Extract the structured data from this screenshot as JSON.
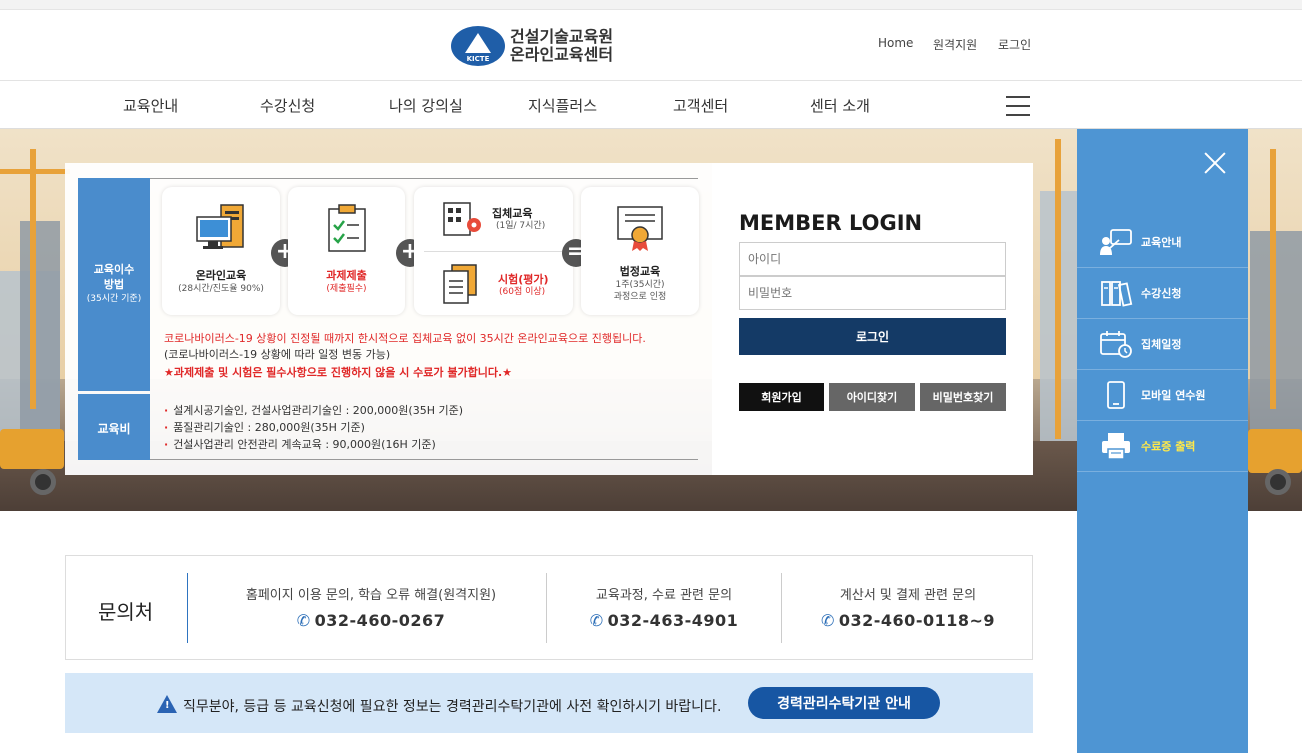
{
  "header": {
    "logo_line1": "건설기술교육원",
    "logo_line2": "온라인교육센터",
    "logo_mark_text": "KICTE",
    "util": [
      "Home",
      "원격지원",
      "로그인"
    ]
  },
  "gnb": {
    "items": [
      "교육안내",
      "수강신청",
      "나의 강의실",
      "지식플러스",
      "고객센터",
      "센터 소개"
    ]
  },
  "info": {
    "method_label_1": "교육이수",
    "method_label_2": "방법",
    "method_label_3": "(35시간 기준)",
    "fee_label": "교육비",
    "card1_title": "온라인교육",
    "card1_sub": "(28시간/진도율 90%)",
    "card2_title": "과제제출",
    "card2_sub": "(제출필수)",
    "card3_title": "집체교육",
    "card3_sub": "(1일/ 7시간)",
    "card3b_title": "시험(평가)",
    "card3b_sub": "(60점 이상)",
    "card4_title": "법정교육",
    "card4_sub1": "1주(35시간)",
    "card4_sub2": "과정으로 인정",
    "op_plus": "+",
    "op_equal": "=",
    "notice1": "코로나바이러스-19 상황이 진정될 때까지 한시적으로 집체교육 없이 35시간 온라인교육으로 진행됩니다.",
    "notice2": "(코로나바이러스-19 상황에 따라 일정 변동 가능)",
    "notice3": "★과제제출 및 시험은 필수사항으로 진행하지 않을 시 수료가 불가합니다.★",
    "fees": [
      "설계시공기술인, 건설사업관리기술인 : 200,000원(35H 기준)",
      "품질관리기술인 : 280,000원(35H 기준)",
      "건설사업관리 안전관리 계속교육 : 90,000원(16H 기준)"
    ]
  },
  "login": {
    "title": "MEMBER LOGIN",
    "id_placeholder": "아이디",
    "pw_placeholder": "비밀번호",
    "login_button": "로그인",
    "join_button": "회원가입",
    "find_id_button": "아이디찾기",
    "find_pw_button": "비밀번호찾기"
  },
  "quick": {
    "items": [
      {
        "label": "교육안내",
        "icon": "teacher-icon"
      },
      {
        "label": "수강신청",
        "icon": "books-icon"
      },
      {
        "label": "집체일정",
        "icon": "calendar-clock-icon"
      },
      {
        "label": "모바일 연수원",
        "icon": "mobile-icon"
      },
      {
        "label": "수료증 출력",
        "icon": "printer-icon"
      }
    ]
  },
  "contact": {
    "title": "문의처",
    "blocks": [
      {
        "question": "홈페이지 이용 문의, 학습 오류 해결(원격지원)",
        "phone": "032-460-0267"
      },
      {
        "question": "교육과정, 수료 관련 문의",
        "phone": "032-463-4901"
      },
      {
        "question": "계산서 및 결제 관련 문의",
        "phone": "032-460-0118~9"
      }
    ]
  },
  "banner": {
    "text": "직무분야, 등급 등 교육신청에 필요한 정보는 경력관리수탁기관에 사전 확인하시기 바랍니다.",
    "button": "경력관리수탁기관 안내"
  },
  "colors": {
    "accent": "#1756a3",
    "login_dark": "#143a66",
    "quick_panel": "#4e95d3",
    "notice_red": "#e02828",
    "highlight_yellow": "#ffe94a"
  }
}
